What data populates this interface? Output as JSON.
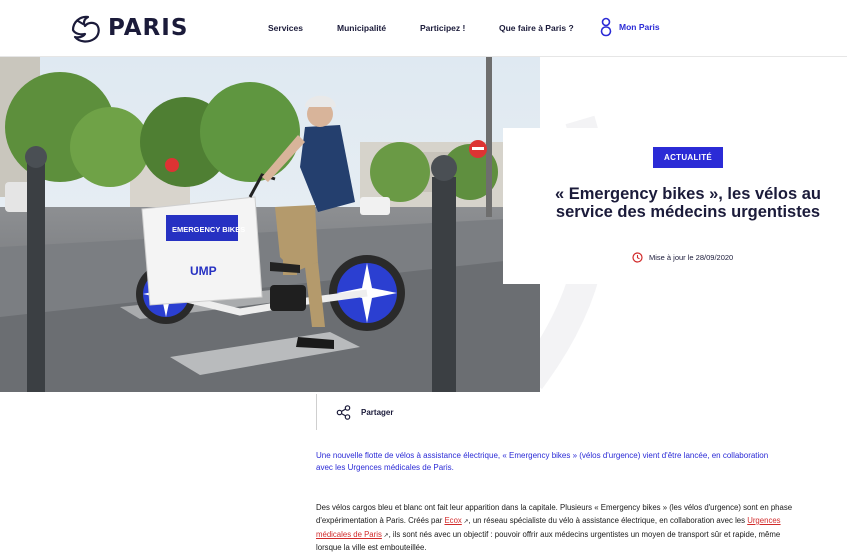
{
  "header": {
    "logo_text": "PARIS",
    "nav": [
      "Services",
      "Municipalité",
      "Participez !",
      "Que faire à Paris ?"
    ],
    "mon_paris": "Mon Paris"
  },
  "hero": {
    "image_alt": "Médecin urgentiste sur un vélo cargo Emergency bikes",
    "bike_box_text": "EMERGENCY BIKES",
    "bike_logo": "UMP"
  },
  "article": {
    "badge": "ACTUALITÉ",
    "title": "« Emergency bikes », les vélos au service des médecins urgentistes",
    "updated": "Mise à jour le 28/09/2020",
    "share_label": "Partager",
    "lead": "Une nouvelle flotte de vélos à assistance électrique, « Emergency bikes » (vélos d'urgence) vient d'être lancée, en collaboration avec les Urgences médicales de Paris.",
    "body": {
      "part1": "Des vélos cargos bleu et blanc ont fait leur apparition dans la capitale. Plusieurs « Emergency bikes » (les vélos d'urgence) sont en phase d'expérimentation à Paris. Créés par ",
      "link1": "Ecox",
      "part2": ", un réseau spécialiste du vélo à assistance électrique, en collaboration avec les ",
      "link2": "Urgences médicales de Paris",
      "part3": ", ils sont nés avec un objectif : pouvoir offrir aux médecins urgentistes un moyen de transport sûr et rapide, même lorsque la ville est embouteillée."
    }
  },
  "colors": {
    "brand_blue": "#2b2bd6",
    "navy": "#1b1b3a",
    "link_red": "#d12a2a"
  },
  "icons": [
    "paris-logo-icon",
    "user-icon",
    "clock-icon",
    "share-icon",
    "external-link-icon"
  ]
}
